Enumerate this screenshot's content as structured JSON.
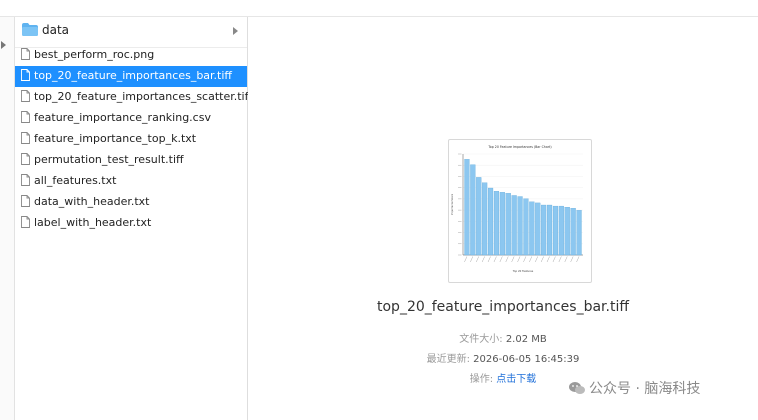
{
  "sidebar": {
    "folder": {
      "name": "data"
    },
    "files": [
      {
        "name": "best_perform_roc.png"
      },
      {
        "name": "top_20_feature_importances_bar.tiff",
        "selected": true
      },
      {
        "name": "top_20_feature_importances_scatter.tiff"
      },
      {
        "name": "feature_importance_ranking.csv"
      },
      {
        "name": "feature_importance_top_k.txt"
      },
      {
        "name": "permutation_test_result.tiff"
      },
      {
        "name": "all_features.txt"
      },
      {
        "name": "data_with_header.txt"
      },
      {
        "name": "label_with_header.txt"
      }
    ]
  },
  "preview": {
    "file_name": "top_20_feature_importances_bar.tiff",
    "size_label": "文件大小:",
    "size_value": "2.02 MB",
    "modified_label": "最近更新:",
    "modified_value": "2026-06-05 16:45:39",
    "action_label": "操作:",
    "action_link": "点击下载"
  },
  "watermark": {
    "text": "公众号 · 脑海科技"
  },
  "colors": {
    "selection": "#1e90ff",
    "bar_fill": "#8cc7f0",
    "folder": "#5fb3f0"
  },
  "chart_data": {
    "type": "bar",
    "title": "Top 20 Feature Importances (Bar Chart)",
    "xlabel": "Top 20 Features",
    "ylabel": "Importance Score",
    "categories": [
      "",
      "",
      "",
      "",
      "",
      "",
      "",
      "",
      "",
      "",
      "",
      "",
      "",
      "",
      "",
      "",
      "",
      "",
      "",
      ""
    ],
    "values": [
      0.9,
      0.85,
      0.73,
      0.68,
      0.63,
      0.6,
      0.59,
      0.58,
      0.56,
      0.55,
      0.53,
      0.5,
      0.49,
      0.47,
      0.47,
      0.46,
      0.46,
      0.45,
      0.44,
      0.42
    ],
    "ylim": [
      0,
      0.95
    ],
    "grid": true
  }
}
